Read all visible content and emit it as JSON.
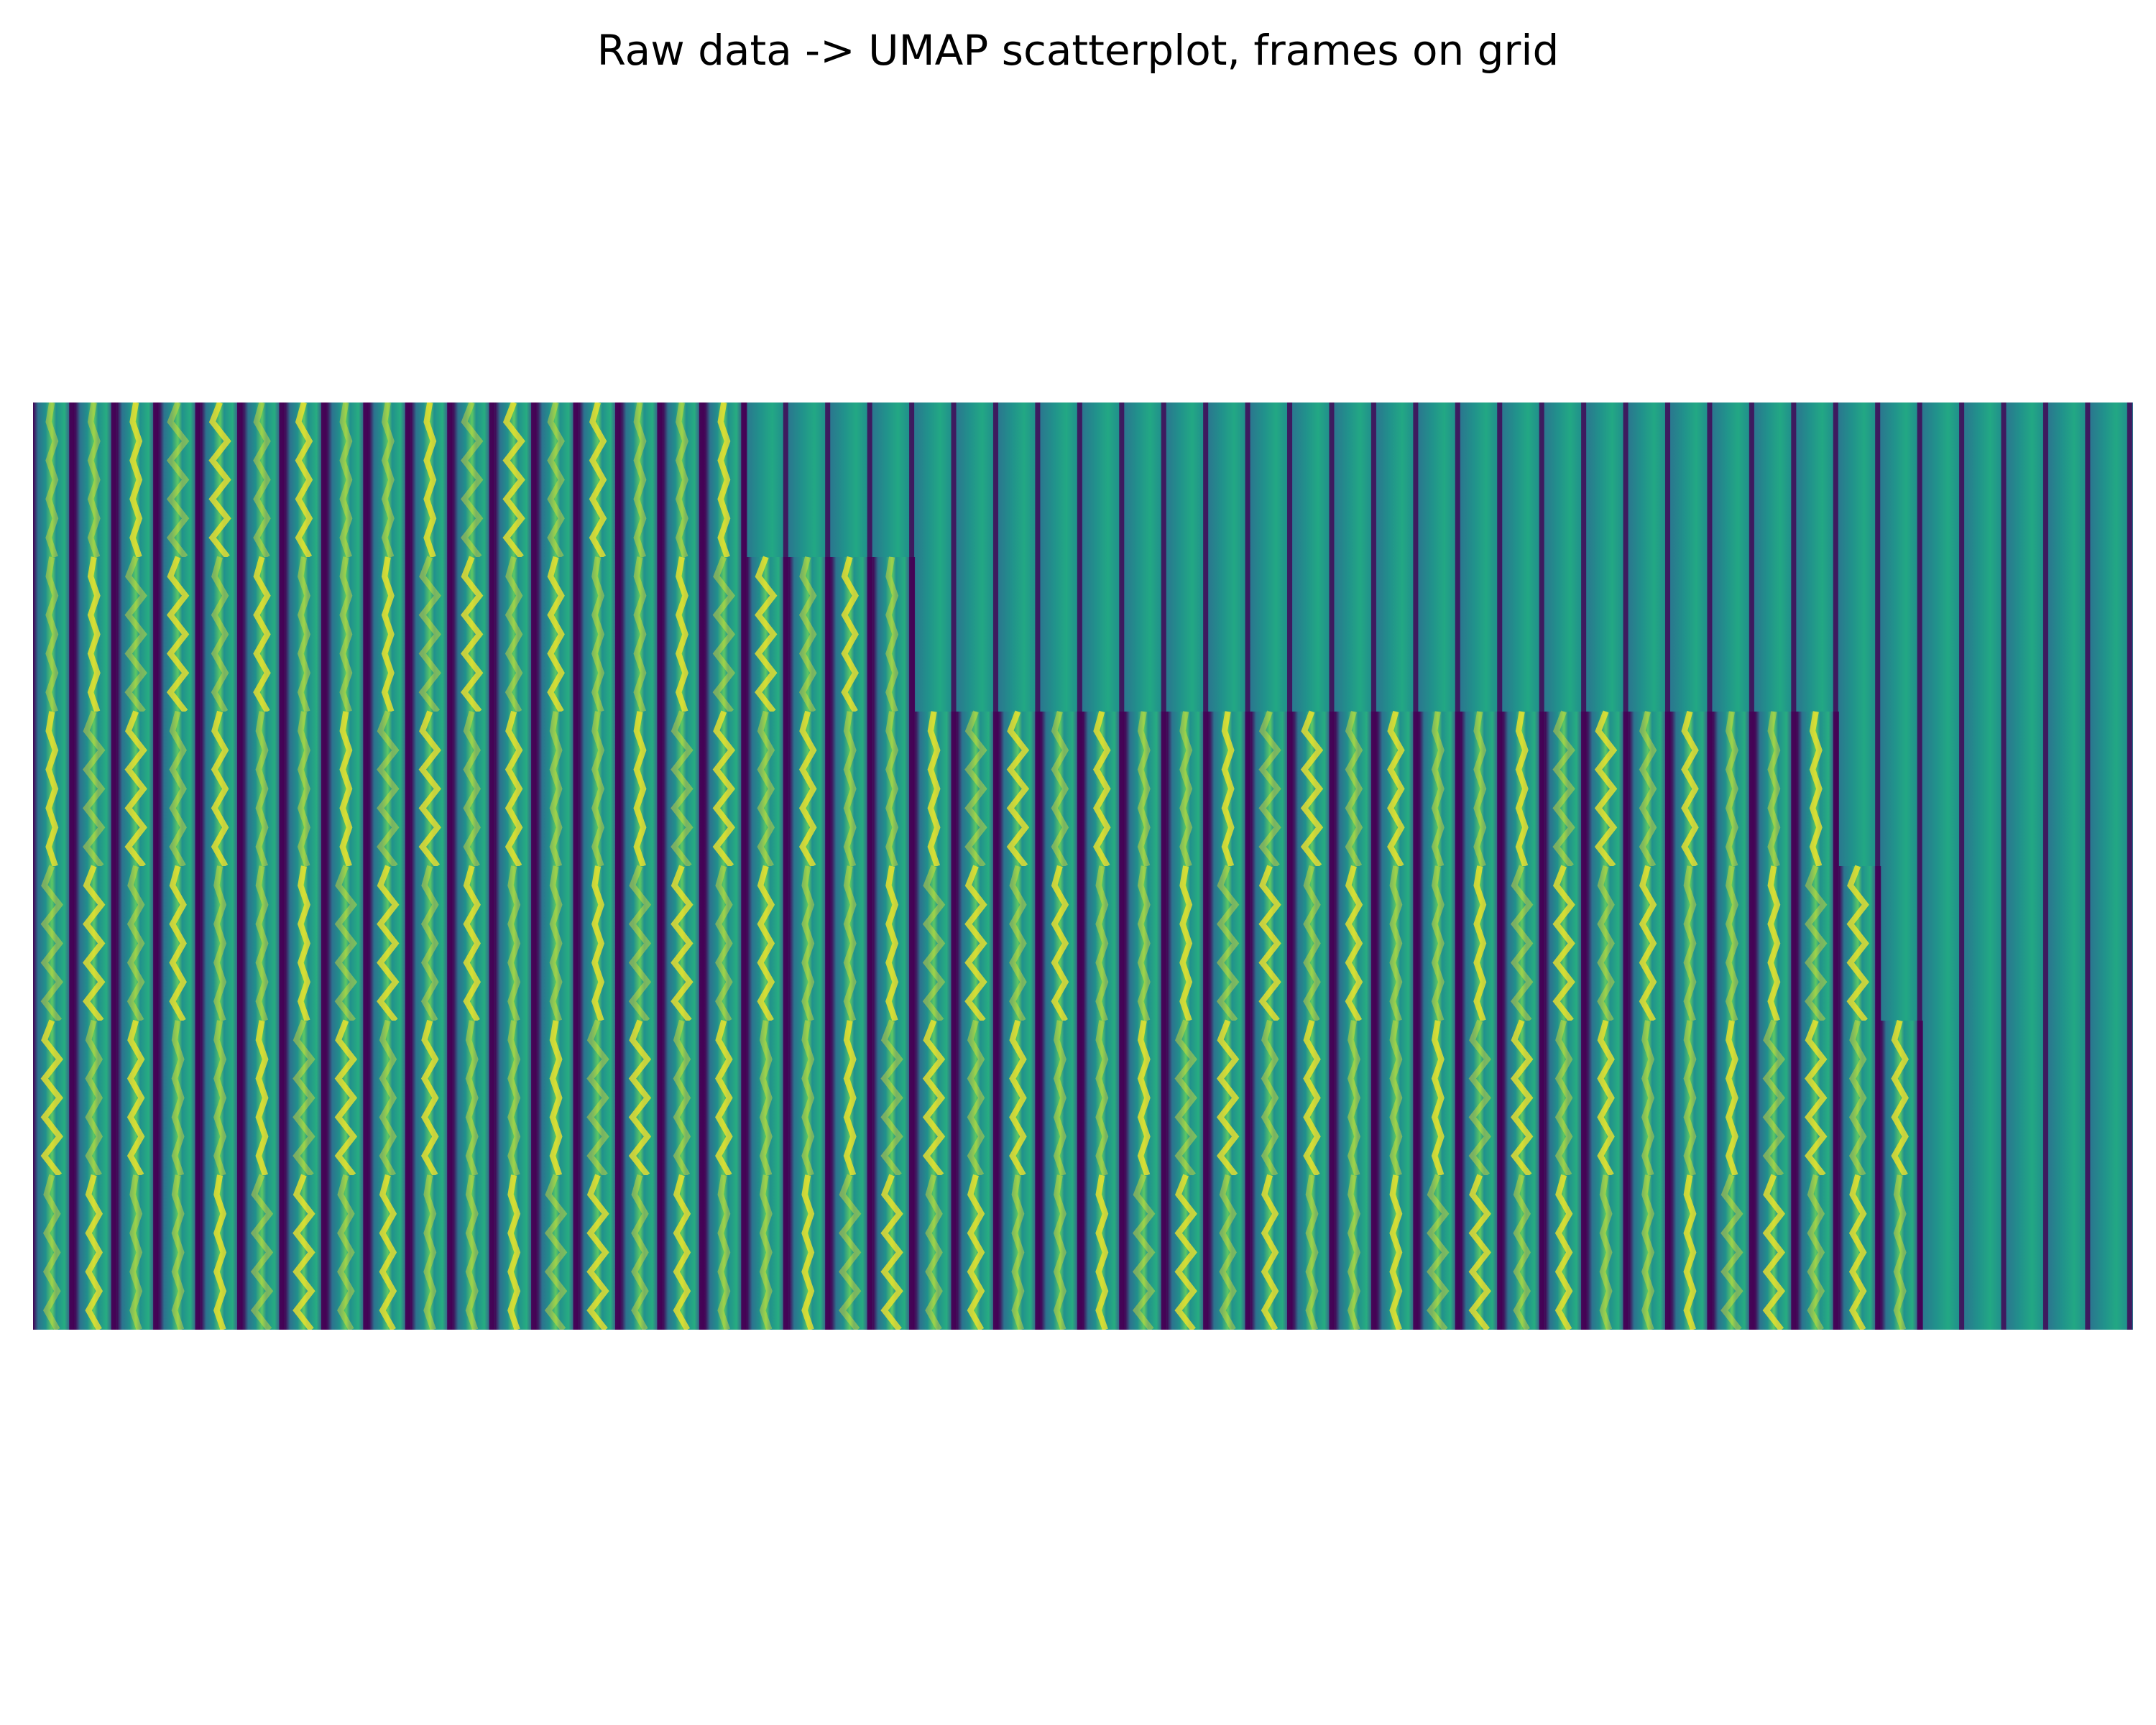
{
  "chart_data": {
    "type": "heatmap",
    "title": "Raw data -> UMAP scatterplot, frames on grid",
    "grid": {
      "rows": 6,
      "columns": 50
    },
    "colormap": "viridis",
    "colors": {
      "background": "#ffffff",
      "viridis_low": "#440154",
      "viridis_mid": "#21918c",
      "viridis_high": "#fde725"
    },
    "axes_visible": false,
    "active_frames_per_row": [
      17,
      21,
      43,
      44,
      45,
      45
    ]
  }
}
